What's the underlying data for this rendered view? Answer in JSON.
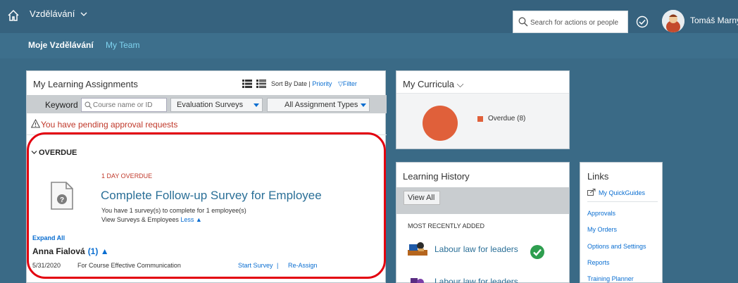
{
  "shell": {
    "app_title": "Vzdělávání",
    "search_placeholder": "Search for actions or people",
    "user_name": "Tomáš Marný"
  },
  "subnav": {
    "items": [
      {
        "label": "Moje Vzdělávání",
        "active": true
      },
      {
        "label": "My Team",
        "active": false
      }
    ]
  },
  "assignments": {
    "title": "My Learning Assignments",
    "sort_prefix": "Sort By Date | ",
    "sort_priority": "Priority",
    "filter": "Filter",
    "keyword_label": "Keyword",
    "keyword_placeholder": "Course name or ID",
    "dropdown_1": "Evaluation Surveys",
    "dropdown_2": "All Assignment Types",
    "pending": "You have pending approval requests",
    "section": "OVERDUE",
    "item": {
      "overdue_label": "1 DAY OVERDUE",
      "title": "Complete Follow-up Survey for Employee",
      "survey_text": "You have 1 survey(s) to complete for 1 employee(s)",
      "view_text": "View Surveys & Employees ",
      "less": "Less ▲"
    },
    "expand_all": "Expand All",
    "employee_name": "Anna Fialová",
    "employee_count": "(1) ▲",
    "row": {
      "date": "5/31/2020",
      "course": "For Course Effective Communication",
      "start_survey": "Start Survey",
      "separator": "|",
      "reassign": "Re-Assign"
    }
  },
  "curricula": {
    "title": "My Curricula",
    "legend": "Overdue (8)",
    "chart_color": "#e0603a"
  },
  "history": {
    "title": "Learning History",
    "view_all": "View All",
    "recent_label": "MOST RECENTLY ADDED",
    "items": [
      {
        "label": "Labour law for leaders",
        "completed": true
      },
      {
        "label": "Labour law for leaders",
        "completed": false
      }
    ]
  },
  "links": {
    "title": "Links",
    "items": [
      "My QuickGuides",
      "Approvals",
      "My Orders",
      "Options and Settings",
      "Reports",
      "Training Planner"
    ]
  },
  "colors": {
    "shell_bg": "#36627e",
    "page_bg": "#3a6a86",
    "link": "#0a6ed1",
    "overdue": "#c0392b",
    "highlight": "#e3000f"
  }
}
